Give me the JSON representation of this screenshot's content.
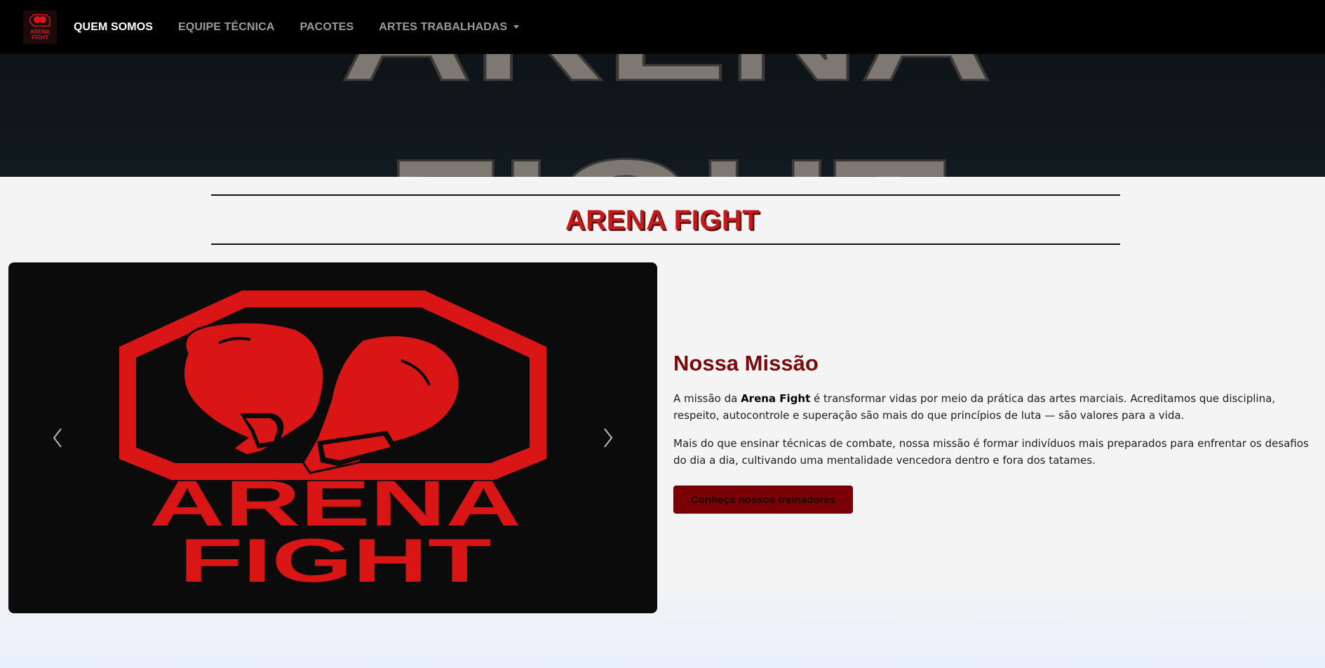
{
  "brand": {
    "logo_text_line1": "ARENA",
    "logo_text_line2": "FIGHT",
    "accent": "#d81616",
    "dark_red": "#7a0a0a"
  },
  "nav": {
    "items": [
      {
        "label": "QUEM SOMOS",
        "active": true
      },
      {
        "label": "EQUIPE TÉCNICA"
      },
      {
        "label": "PACOTES"
      },
      {
        "label": "ARTES TRABALHADAS",
        "dropdown": true
      }
    ]
  },
  "hero": {
    "text_top": "ARENA",
    "text_bottom": "FIGHT"
  },
  "section": {
    "title": "ARENA FIGHT"
  },
  "carousel": {
    "slide_text_1": "ARENA",
    "slide_text_2": "FIGHT",
    "prev_icon": "chevron-left-icon",
    "next_icon": "chevron-right-icon"
  },
  "mission": {
    "title": "Nossa Missão",
    "p1_before": "A missão da ",
    "p1_bold": "Arena Fight",
    "p1_after": " é transformar vidas por meio da prática das artes marciais. Acreditamos que disciplina, respeito, autocontrole e superação são mais do que princípios de luta — são valores para a vida.",
    "p2": "Mais do que ensinar técnicas de combate, nossa missão é formar indivíduos mais preparados para enfrentar os desafios do dia a dia, cultivando uma mentalidade vencedora dentro e fora dos tatames.",
    "button_label": "Conheça nossos treinadores"
  }
}
